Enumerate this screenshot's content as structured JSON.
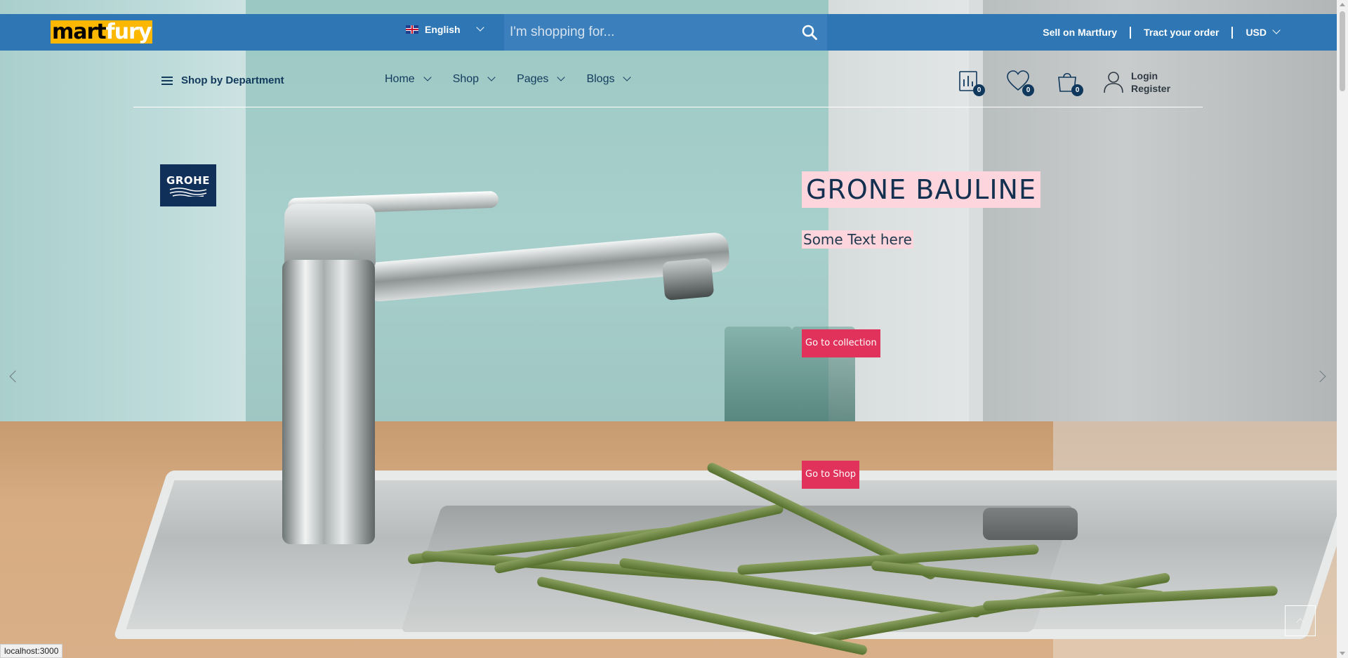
{
  "header": {
    "logo": {
      "part1": "mart",
      "part2": "fury",
      "bg_color": "#fcb800"
    },
    "bar_color": "#2f77b4",
    "language": {
      "flag_icon": "uk-flag-icon",
      "label": "English"
    },
    "search": {
      "placeholder": "I'm shopping for...",
      "value": ""
    },
    "links": {
      "sell": "Sell on Martfury",
      "track": "Tract your order",
      "currency": "USD"
    }
  },
  "nav": {
    "department": "Shop by Department",
    "menu": [
      {
        "label": "Home"
      },
      {
        "label": "Shop"
      },
      {
        "label": "Pages"
      },
      {
        "label": "Blogs"
      }
    ],
    "badges": {
      "compare": "0",
      "wishlist": "0",
      "cart": "0"
    },
    "account": {
      "login": "Login",
      "register": "Register"
    }
  },
  "slide": {
    "brand": "GROHE",
    "title": "GRONE BAULINE",
    "subtitle": "Some Text here",
    "button_collection": "Go to collection",
    "button_shop": "Go to Shop",
    "accent_color": "#e0325a",
    "highlight_color": "#fcd6dc"
  },
  "status_bar": {
    "url": "localhost:3000"
  }
}
